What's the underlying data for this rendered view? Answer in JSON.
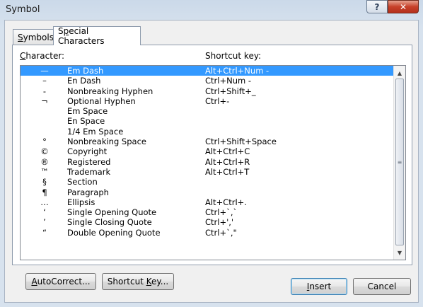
{
  "window": {
    "title": "Symbol",
    "help_glyph": "?",
    "close_glyph": "✕"
  },
  "tabs": [
    {
      "label_pre": "",
      "label_key": "S",
      "label_post": "ymbols"
    },
    {
      "label_pre": "S",
      "label_key": "p",
      "label_post": "ecial Characters"
    }
  ],
  "list": {
    "character_header_key": "C",
    "character_header_post": "haracter:",
    "shortcut_header": "Shortcut key:",
    "rows": [
      {
        "char": "—",
        "name": "Em Dash",
        "key": "Alt+Ctrl+Num -"
      },
      {
        "char": "–",
        "name": "En Dash",
        "key": "Ctrl+Num -"
      },
      {
        "char": "-",
        "name": "Nonbreaking Hyphen",
        "key": "Ctrl+Shift+_"
      },
      {
        "char": "¬",
        "name": "Optional Hyphen",
        "key": "Ctrl+-"
      },
      {
        "char": "",
        "name": "Em Space",
        "key": ""
      },
      {
        "char": "",
        "name": "En Space",
        "key": ""
      },
      {
        "char": "",
        "name": "1/4 Em Space",
        "key": ""
      },
      {
        "char": "°",
        "name": "Nonbreaking Space",
        "key": "Ctrl+Shift+Space"
      },
      {
        "char": "©",
        "name": "Copyright",
        "key": "Alt+Ctrl+C"
      },
      {
        "char": "®",
        "name": "Registered",
        "key": "Alt+Ctrl+R"
      },
      {
        "char": "™",
        "name": "Trademark",
        "key": "Alt+Ctrl+T"
      },
      {
        "char": "§",
        "name": "Section",
        "key": ""
      },
      {
        "char": "¶",
        "name": "Paragraph",
        "key": ""
      },
      {
        "char": "…",
        "name": "Ellipsis",
        "key": "Alt+Ctrl+."
      },
      {
        "char": "‘",
        "name": "Single Opening Quote",
        "key": "Ctrl+`,`"
      },
      {
        "char": "’",
        "name": "Single Closing Quote",
        "key": "Ctrl+','"
      },
      {
        "char": "“",
        "name": "Double Opening Quote",
        "key": "Ctrl+`,\""
      }
    ],
    "selected_index": 0
  },
  "buttons": {
    "autocorrect": {
      "key": "A",
      "post": "utoCorrect..."
    },
    "shortcut": {
      "pre": "Shortcut ",
      "key": "K",
      "post": "ey..."
    },
    "insert": {
      "key": "I",
      "post": "nsert"
    },
    "cancel": "Cancel"
  },
  "scrollbar": {
    "up": "▲",
    "down": "▼",
    "grip": "≡"
  }
}
